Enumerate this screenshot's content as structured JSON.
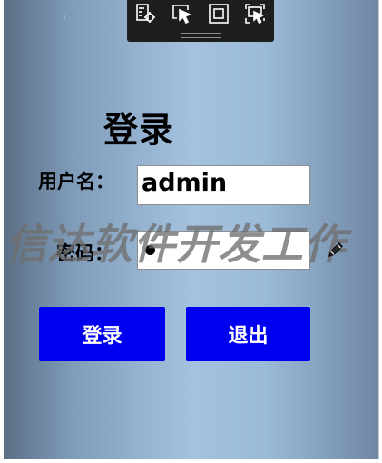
{
  "devtools": {
    "icons": [
      "select-element-icon",
      "pointer-select-icon",
      "frame-toggle-icon",
      "screen-capture-icon"
    ]
  },
  "login": {
    "title": "登录",
    "username_label": "用户名：",
    "username_value": "admin",
    "password_label": "密码：",
    "login_button": "登录",
    "exit_button": "退出"
  },
  "watermark": "信达软件开发工作",
  "colors": {
    "button": "#0000f0",
    "button_text": "#ffffff",
    "devbar": "#1e1e1e"
  }
}
